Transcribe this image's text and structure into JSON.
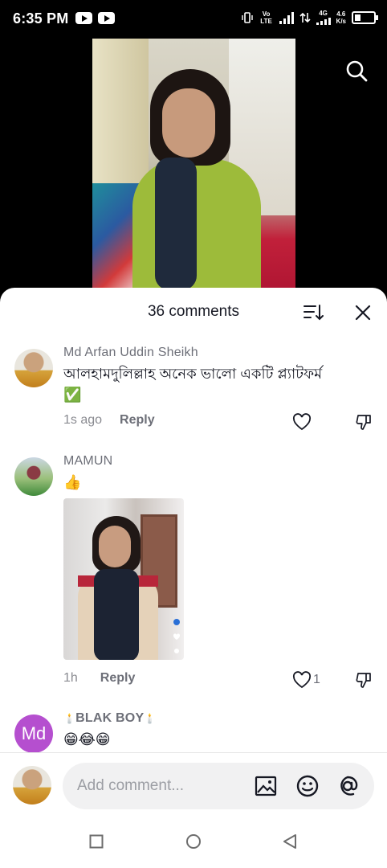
{
  "status_bar": {
    "time": "6:35 PM",
    "network_label": "Vo LTE",
    "network_type": "4G",
    "speed_value": "4.6",
    "speed_unit": "K/s"
  },
  "video": {
    "search_icon": "search-icon"
  },
  "comments_sheet": {
    "count_label": "36 comments",
    "sort_icon": "sort-icon",
    "close_icon": "close-icon",
    "comments": [
      {
        "username": "Md Arfan Uddin Sheikh",
        "text": "আলহামদুলিল্লাহ অনেক ভালো একটি প্ল্যাটফর্ম",
        "emoji": "✅",
        "time": "1s ago",
        "reply_label": "Reply",
        "likes": ""
      },
      {
        "username": "MAMUN",
        "text": "👍",
        "time": "1h",
        "reply_label": "Reply",
        "likes": "1"
      },
      {
        "username": "BLAK BOY",
        "username_decor_left": "🕯️",
        "username_decor_right": "🕯️",
        "avatar_initials": "Md",
        "text": "😁😂😁"
      }
    ]
  },
  "comment_input": {
    "placeholder": "Add comment...",
    "image_icon": "image-icon",
    "emoji_icon": "emoji-icon",
    "mention_icon": "mention-icon"
  },
  "colors": {
    "text_primary": "#161823",
    "text_secondary": "#6d6f78",
    "avatar_purple": "#b54fcf",
    "input_bg": "#f1f1f2"
  }
}
